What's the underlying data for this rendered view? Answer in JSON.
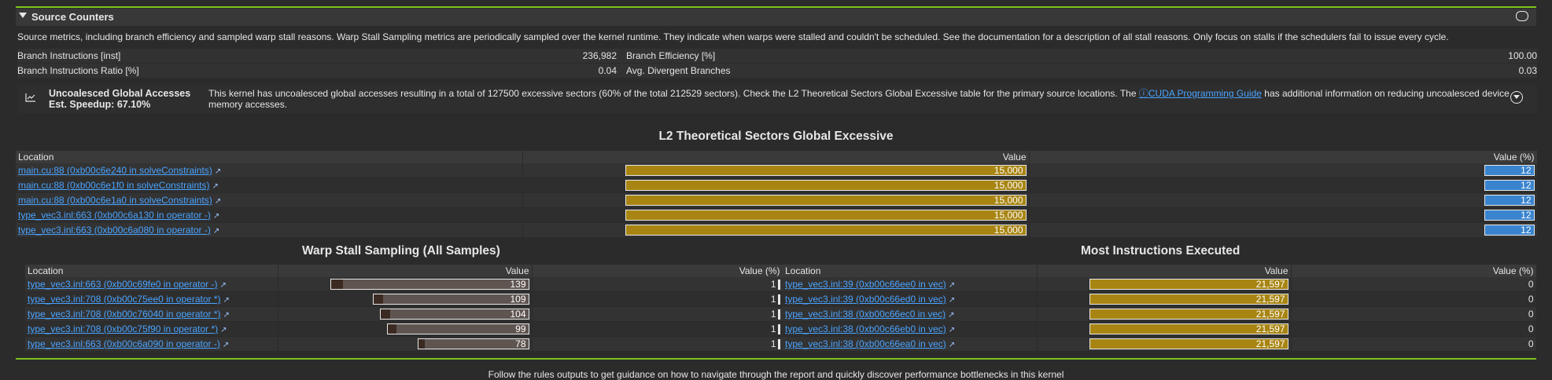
{
  "section": {
    "title": "Source Counters"
  },
  "description": "Source metrics, including branch efficiency and sampled warp stall reasons. Warp Stall Sampling metrics are periodically sampled over the kernel runtime. They indicate when warps were stalled and couldn't be scheduled. See the documentation for a description of all stall reasons. Only focus on stalls if the schedulers fail to issue every cycle.",
  "metrics": [
    {
      "l_name": "Branch Instructions [inst]",
      "l_value": "236,982",
      "r_name": "Branch Efficiency [%]",
      "r_value": "100.00"
    },
    {
      "l_name": "Branch Instructions Ratio [%]",
      "l_value": "0.04",
      "r_name": "Avg. Divergent Branches",
      "r_value": "0.03"
    }
  ],
  "recommendation": {
    "title": "Uncoalesced Global Accesses",
    "speedup": "Est. Speedup: 67.10%",
    "text_before": "This kernel has uncoalesced global accesses resulting in a total of 127500 excessive sectors (60% of the total 212529 sectors). Check the L2 Theoretical Sectors Global Excessive table for the primary source locations. The ",
    "link_icon": "ⓘ",
    "link": "CUDA Programming Guide",
    "text_after": " has additional information on reducing uncoalesced device memory accesses."
  },
  "l2_table": {
    "title": "L2 Theoretical Sectors Global Excessive",
    "headers": [
      "Location",
      "Value",
      "Value (%)"
    ],
    "rows": [
      {
        "loc": "main.cu:88 (0xb00c6e240 in solveConstraints)",
        "value": "15,000",
        "pct": "12"
      },
      {
        "loc": "main.cu:88 (0xb00c6e1f0 in solveConstraints)",
        "value": "15,000",
        "pct": "12"
      },
      {
        "loc": "main.cu:88 (0xb00c6e1a0 in solveConstraints)",
        "value": "15,000",
        "pct": "12"
      },
      {
        "loc": "type_vec3.inl:663 (0xb00c6a130 in operator -)",
        "value": "15,000",
        "pct": "12"
      },
      {
        "loc": "type_vec3.inl:663 (0xb00c6a080 in operator -)",
        "value": "15,000",
        "pct": "12"
      }
    ]
  },
  "warp_table": {
    "title": "Warp Stall Sampling (All Samples)",
    "headers": [
      "Location",
      "Value",
      "Value (%)"
    ],
    "rows": [
      {
        "loc": "type_vec3.inl:663 (0xb00c69fe0 in operator -)",
        "value": "139",
        "pct": "1"
      },
      {
        "loc": "type_vec3.inl:708 (0xb00c75ee0 in operator *)",
        "value": "109",
        "pct": "1"
      },
      {
        "loc": "type_vec3.inl:708 (0xb00c76040 in operator *)",
        "value": "104",
        "pct": "1"
      },
      {
        "loc": "type_vec3.inl:708 (0xb00c75f90 in operator *)",
        "value": "99",
        "pct": "1"
      },
      {
        "loc": "type_vec3.inl:663 (0xb00c6a090 in operator -)",
        "value": "78",
        "pct": "1"
      }
    ]
  },
  "instr_table": {
    "title": "Most Instructions Executed",
    "headers": [
      "Location",
      "Value",
      "Value (%)"
    ],
    "rows": [
      {
        "loc": "type_vec3.inl:39 (0xb00c66ee0 in vec)",
        "value": "21,597",
        "pct": "0"
      },
      {
        "loc": "type_vec3.inl:39 (0xb00c66ed0 in vec)",
        "value": "21,597",
        "pct": "0"
      },
      {
        "loc": "type_vec3.inl:38 (0xb00c66ec0 in vec)",
        "value": "21,597",
        "pct": "0"
      },
      {
        "loc": "type_vec3.inl:38 (0xb00c66eb0 in vec)",
        "value": "21,597",
        "pct": "0"
      },
      {
        "loc": "type_vec3.inl:38 (0xb00c66ea0 in vec)",
        "value": "21,597",
        "pct": "0"
      }
    ]
  },
  "footer": "Follow the rules outputs to get guidance on how to navigate through the report and quickly discover performance bottlenecks in this kernel",
  "colors": {
    "accent_green": "#7fc31c",
    "bar_gold": "#a88512",
    "bar_blue": "#3a84cf",
    "link": "#4aa3ff"
  },
  "icons": {
    "collapse": "triangle-down-icon",
    "comment": "comment-icon",
    "rec": "chart-icon",
    "expand": "expand-icon",
    "external": "external-link-icon"
  }
}
